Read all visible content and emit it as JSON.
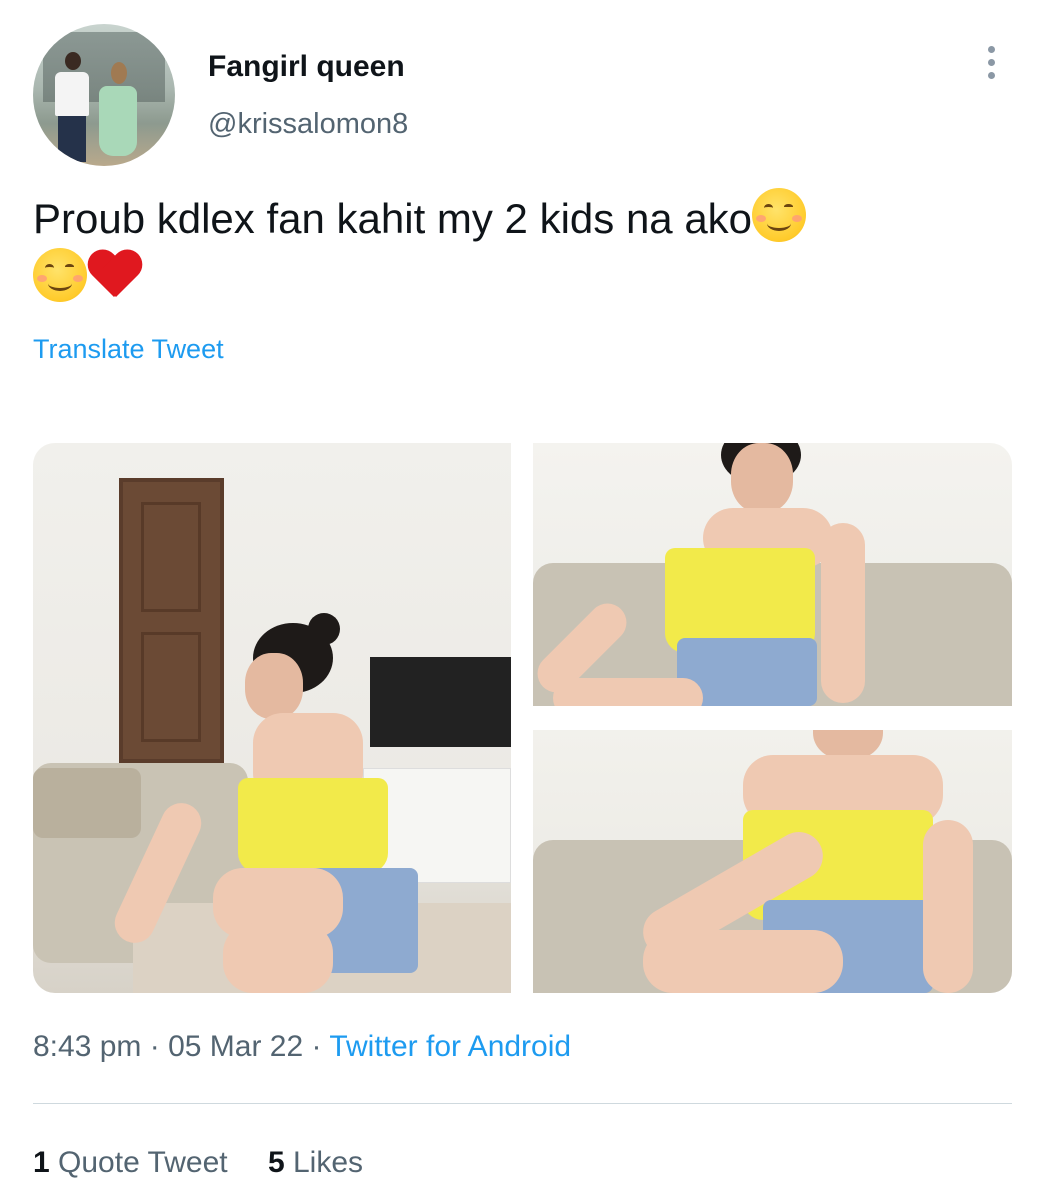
{
  "user": {
    "name": "Fangirl queen",
    "handle": "@krissalomon8"
  },
  "tweet": {
    "text_line1": "Proub kdlex fan kahit my 2 kids na ako",
    "emojis_line1": [
      "smiling-face-with-smiling-eyes"
    ],
    "emojis_line2": [
      "smiling-face-with-smiling-eyes",
      "red-heart"
    ],
    "translate_label": "Translate Tweet"
  },
  "media": {
    "photos": [
      {
        "name": "photo-1"
      },
      {
        "name": "photo-2"
      },
      {
        "name": "photo-3"
      }
    ]
  },
  "meta": {
    "time": "8:43 pm",
    "date": "05 Mar 22",
    "separator": "·",
    "source": "Twitter for Android"
  },
  "stats": {
    "quote_count": "1",
    "quote_label": "Quote Tweet",
    "like_count": "5",
    "like_label": "Likes"
  },
  "colors": {
    "link": "#1d9bf0",
    "secondary_text": "#536471",
    "primary_text": "#0f1419"
  }
}
